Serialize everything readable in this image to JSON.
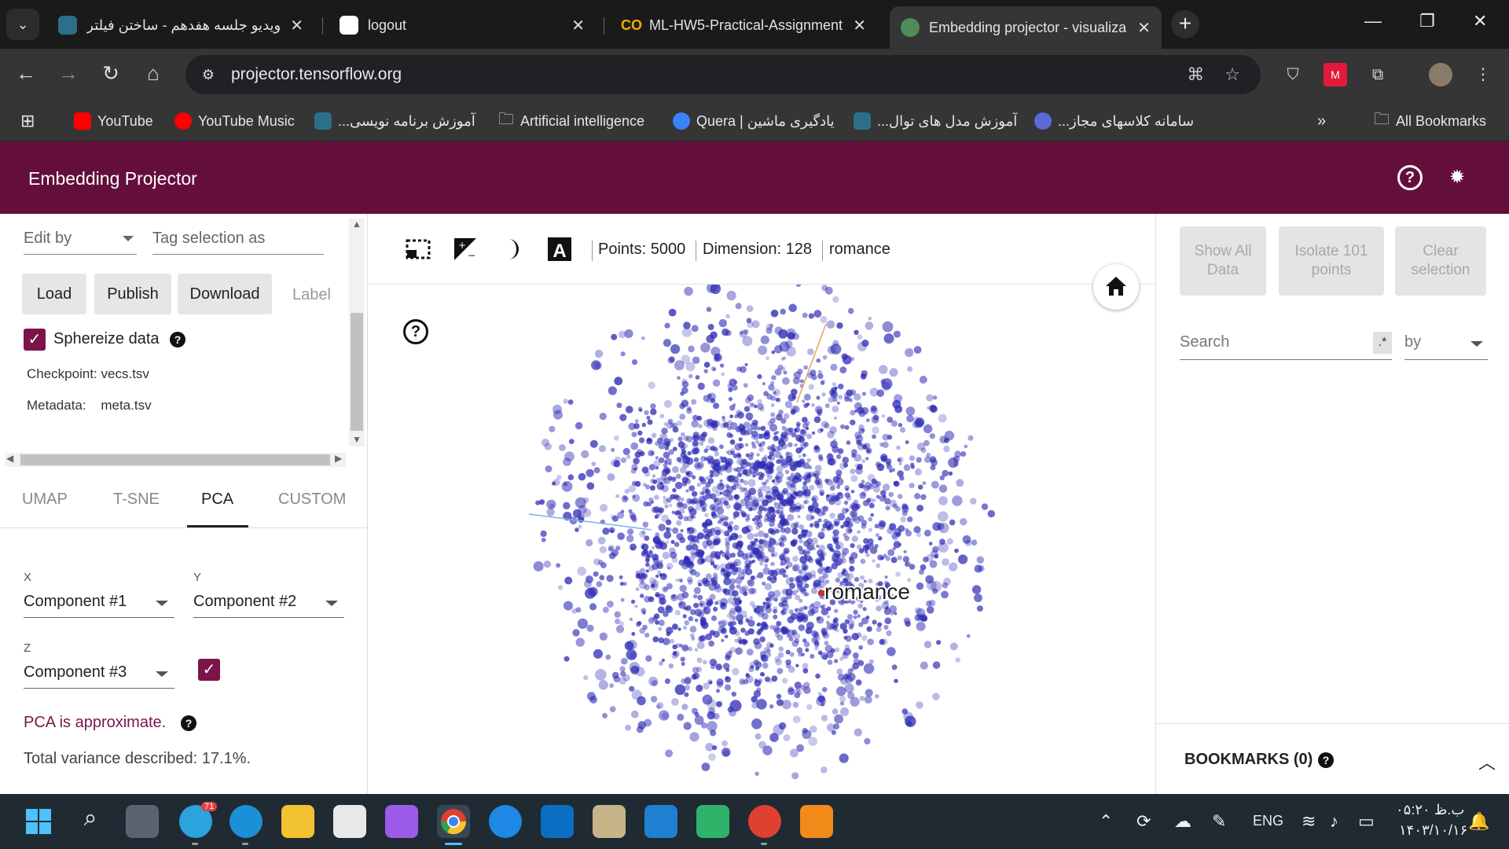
{
  "browser": {
    "tabs": [
      {
        "title": "ویدیو جلسه هفدهم - ساختن فیلتر",
        "icon": "site-logo-icon",
        "active": false
      },
      {
        "title": "logout",
        "icon": "notion-icon",
        "active": false
      },
      {
        "title": "ML-HW5-Practical-Assignment",
        "icon": "colab-icon",
        "active": false
      },
      {
        "title": "Embedding projector - visualiza",
        "icon": "globe-icon",
        "active": true
      }
    ],
    "url": "projector.tensorflow.org",
    "bookmarks": [
      {
        "label": "YouTube",
        "icon": "youtube-icon",
        "color": "#ff0000"
      },
      {
        "label": "YouTube Music",
        "icon": "youtube-music-icon",
        "color": "#ff0000"
      },
      {
        "label": "آموزش برنامه نویسی...",
        "icon": "site-logo-icon",
        "color": "#4fa3c7"
      },
      {
        "label": "Artificial intelligence",
        "icon": "folder-icon",
        "color": "#cccccc"
      },
      {
        "label": "Quera | یادگیری ماشین",
        "icon": "quera-icon",
        "color": "#3b82f6"
      },
      {
        "label": "آموزش مدل های توال...",
        "icon": "site-logo-icon",
        "color": "#4fa3c7"
      },
      {
        "label": "سامانه کلاسهای مجاز...",
        "icon": "university-icon",
        "color": "#5b6bd6"
      }
    ],
    "all_bookmarks": "All Bookmarks"
  },
  "app": {
    "title": "Embedding Projector",
    "accent": "#640f3b"
  },
  "left": {
    "edit_by": "Edit by",
    "tag_selection": "Tag selection as",
    "load": "Load",
    "publish": "Publish",
    "download": "Download",
    "label": "Label",
    "spherize": "Sphereize data",
    "checkpoint_label": "Checkpoint:",
    "checkpoint_value": "vecs.tsv",
    "metadata_label": "Metadata:",
    "metadata_value": "meta.tsv",
    "tabs": [
      "UMAP",
      "T-SNE",
      "PCA",
      "CUSTOM"
    ],
    "x_label": "X",
    "y_label": "Y",
    "z_label": "Z",
    "x_value": "Component #1",
    "y_value": "Component #2",
    "z_value": "Component #3",
    "pca_warning": "PCA is approximate.",
    "variance": "Total variance described: 17.1%."
  },
  "center": {
    "points": "Points: 5000",
    "dimension": "Dimension: 128",
    "selected": "romance",
    "point_label": "romance",
    "point_color": "#2d2bb5"
  },
  "right": {
    "show_all": "Show All Data",
    "isolate": "Isolate 101 points",
    "clear": "Clear selection",
    "search_placeholder": "Search",
    "regex": ".*",
    "by": "by",
    "bookmarks": "BOOKMARKS (0)"
  },
  "taskbar": {
    "telegram_badge": "71",
    "lang": "ENG",
    "time": "۰۵:۲۰ ب.ظ",
    "date": "۱۴۰۳/۱۰/۱۶"
  }
}
